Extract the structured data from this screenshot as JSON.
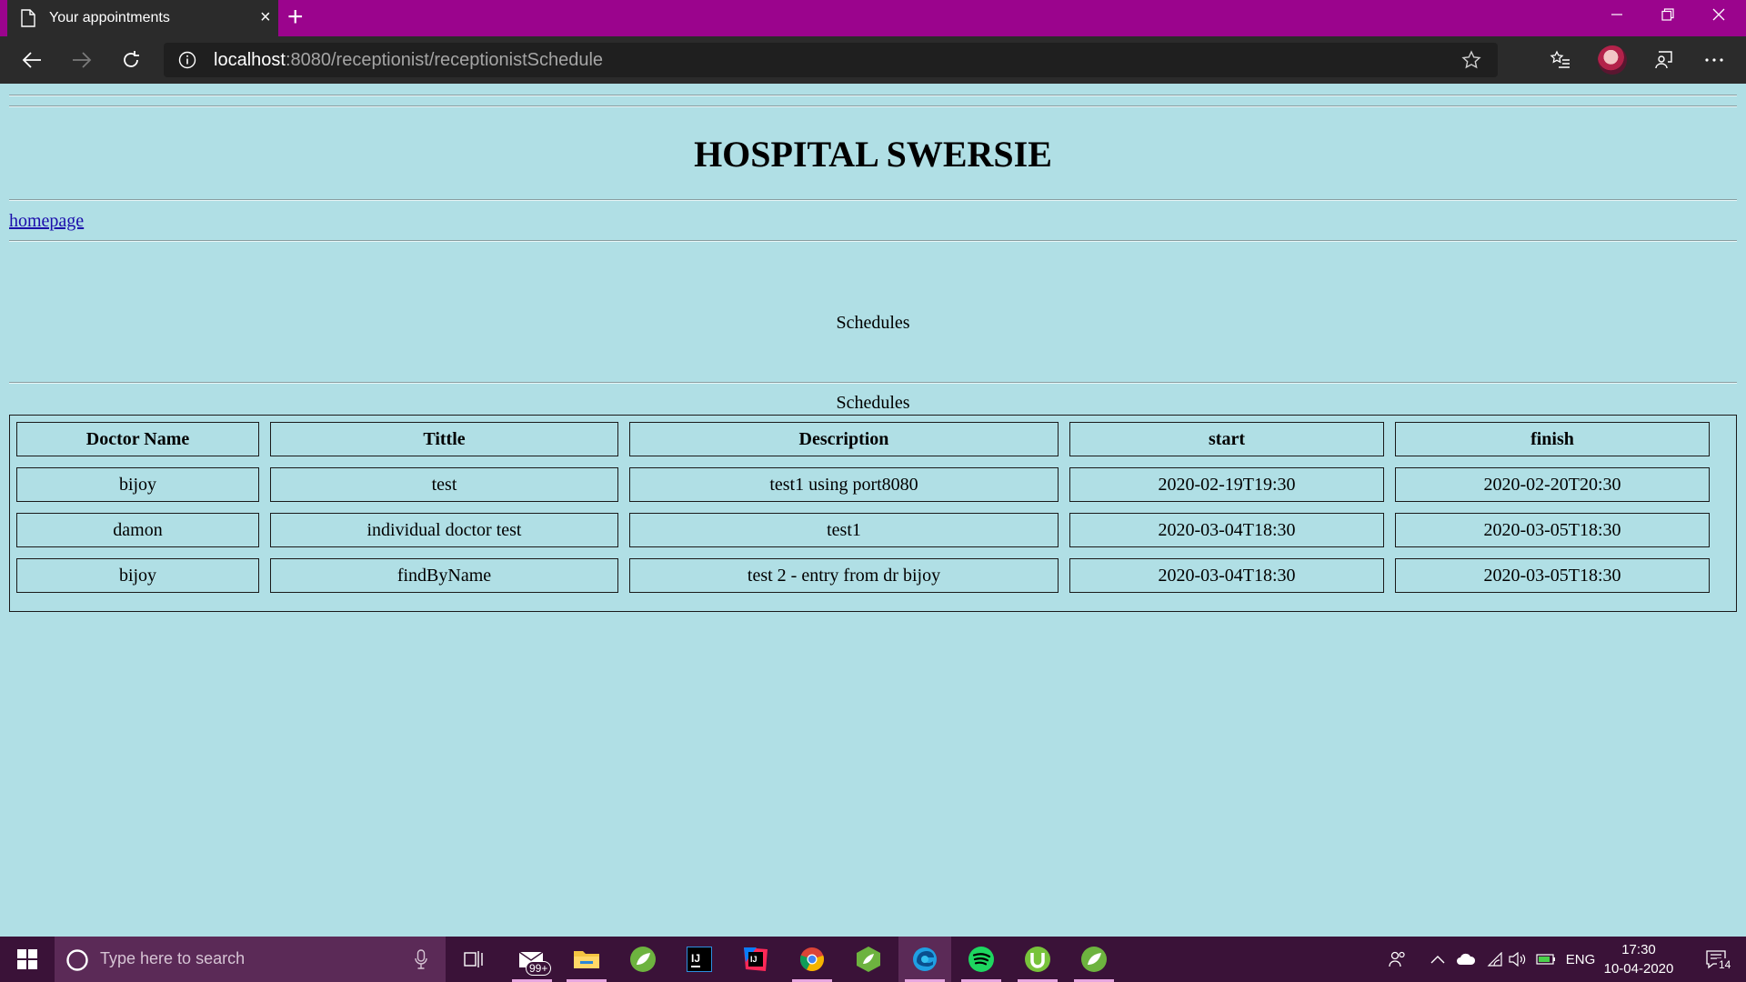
{
  "browser": {
    "tab_title": "Your appointments",
    "url_host": "localhost",
    "url_path": ":8080/receptionist/receptionistSchedule"
  },
  "page": {
    "title": "HOSPITAL SWERSIE",
    "home_link": "homepage",
    "schedules_heading": "Schedules",
    "table_caption": "Schedules"
  },
  "table": {
    "headers": [
      "Doctor Name",
      "Tittle",
      "Description",
      "start",
      "finish"
    ],
    "rows": [
      [
        "bijoy",
        "test",
        "test1 using port8080",
        "2020-02-19T19:30",
        "2020-02-20T20:30"
      ],
      [
        "damon",
        "individual doctor test",
        "test1",
        "2020-03-04T18:30",
        "2020-03-05T18:30"
      ],
      [
        "bijoy",
        "findByName",
        "test 2 - entry from dr bijoy",
        "2020-03-04T18:30",
        "2020-03-05T18:30"
      ]
    ]
  },
  "taskbar": {
    "search_placeholder": "Type here to search",
    "mail_badge": "99+",
    "language": "ENG",
    "time": "17:30",
    "date": "10-04-2020",
    "notification_count": "14"
  },
  "colors": {
    "title_bar": "#9b048d",
    "page_background": "#b0dfe5",
    "taskbar": "#3a1238"
  }
}
